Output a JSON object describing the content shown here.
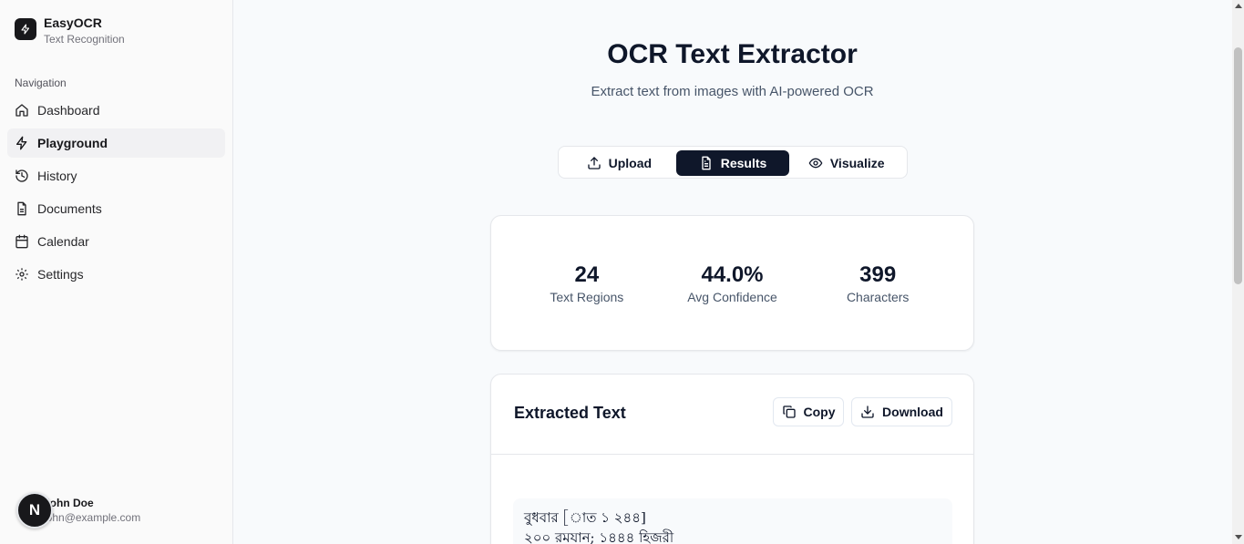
{
  "brand": {
    "name": "EasyOCR",
    "subtitle": "Text Recognition"
  },
  "sidebar": {
    "section_label": "Navigation",
    "items": [
      {
        "label": "Dashboard",
        "icon": "home-icon"
      },
      {
        "label": "Playground",
        "icon": "bolt-icon",
        "active": true
      },
      {
        "label": "History",
        "icon": "history-icon"
      },
      {
        "label": "Documents",
        "icon": "document-icon"
      },
      {
        "label": "Calendar",
        "icon": "calendar-icon"
      },
      {
        "label": "Settings",
        "icon": "gear-icon"
      }
    ]
  },
  "user": {
    "initial": "N",
    "name": "John Doe",
    "email": "john@example.com"
  },
  "page": {
    "title": "OCR Text Extractor",
    "subtitle": "Extract text from images with AI-powered OCR"
  },
  "tabs": [
    {
      "label": "Upload",
      "icon": "upload-icon"
    },
    {
      "label": "Results",
      "icon": "file-text-icon",
      "active": true
    },
    {
      "label": "Visualize",
      "icon": "eye-icon"
    }
  ],
  "stats": [
    {
      "value": "24",
      "label": "Text Regions"
    },
    {
      "value": "44.0%",
      "label": "Avg Confidence"
    },
    {
      "value": "399",
      "label": "Characters"
    }
  ],
  "extracted": {
    "title": "Extracted Text",
    "copy_label": "Copy",
    "download_label": "Download",
    "lines": [
      "বুধবার [াত ১ ২৪৪]",
      "২০০ রমযান; ১৪৪৪ হিজরী"
    ]
  },
  "colors": {
    "primary": "#0f172a",
    "sidebar_bg": "#fafafa",
    "page_bg": "#f8fafc"
  }
}
